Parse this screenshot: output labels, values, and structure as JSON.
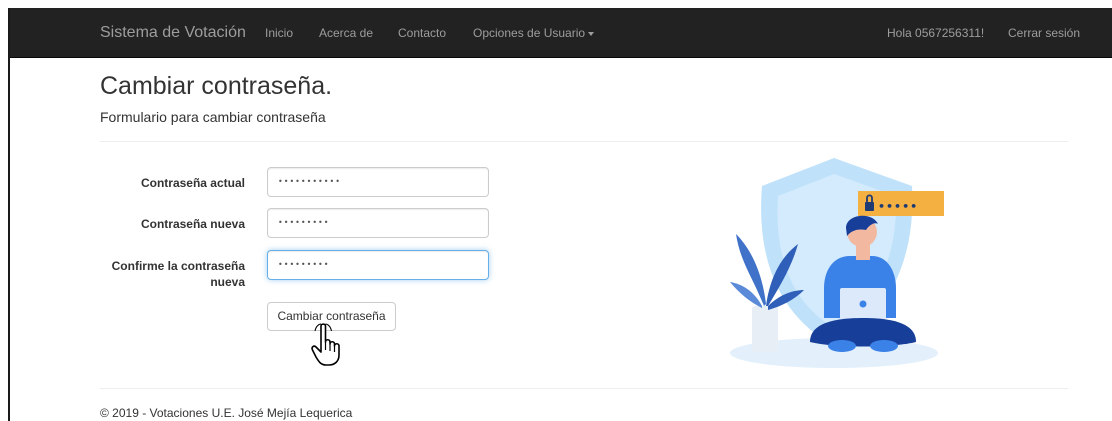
{
  "navbar": {
    "brand": "Sistema de Votación",
    "links": [
      {
        "label": "Inicio"
      },
      {
        "label": "Acerca de"
      },
      {
        "label": "Contacto"
      },
      {
        "label": "Opciones de Usuario"
      }
    ],
    "greeting": "Hola 0567256311!",
    "logout": "Cerrar sesión"
  },
  "header": {
    "title": "Cambiar contraseña.",
    "subtitle": "Formulario para cambiar contraseña"
  },
  "form": {
    "current_password": {
      "label": "Contraseña actual",
      "value": "•••••••••••"
    },
    "new_password": {
      "label": "Contraseña nueva",
      "value": "•••••••••"
    },
    "confirm_password": {
      "label_line1": "Confirme la contraseña",
      "label_line2": "nueva",
      "value": "•••••••••"
    },
    "submit_label": "Cambiar contraseña"
  },
  "illustration": {
    "password_badge": "•••••"
  },
  "footer": {
    "text": "© 2019 - Votaciones U.E. José Mejía Lequerica"
  },
  "colors": {
    "navbar_bg": "#222222",
    "nav_text": "#9d9d9d",
    "focus_border": "#66afe9",
    "shield": "#bfe1fa",
    "badge": "#f5b042",
    "person_shirt": "#3b82e8",
    "person_pants": "#173f9a"
  }
}
